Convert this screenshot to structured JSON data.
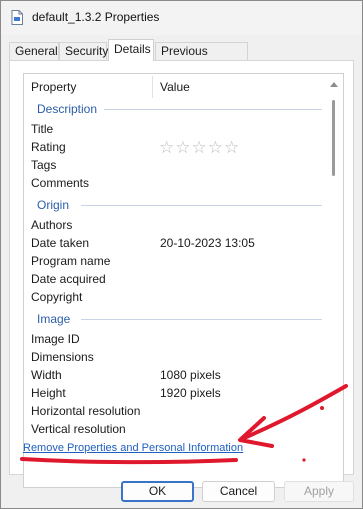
{
  "window": {
    "title": "default_1.3.2 Properties"
  },
  "tabs": [
    {
      "label": "General"
    },
    {
      "label": "Security"
    },
    {
      "label": "Details"
    },
    {
      "label": "Previous Versions"
    }
  ],
  "list": {
    "headers": {
      "property": "Property",
      "value": "Value"
    },
    "groups": {
      "description": {
        "label": "Description",
        "rows": [
          {
            "key": "Title",
            "value": ""
          },
          {
            "key": "Rating",
            "value": ""
          },
          {
            "key": "Tags",
            "value": ""
          },
          {
            "key": "Comments",
            "value": ""
          }
        ]
      },
      "origin": {
        "label": "Origin",
        "rows": [
          {
            "key": "Authors",
            "value": ""
          },
          {
            "key": "Date taken",
            "value": "20-10-2023 13:05"
          },
          {
            "key": "Program name",
            "value": ""
          },
          {
            "key": "Date acquired",
            "value": ""
          },
          {
            "key": "Copyright",
            "value": ""
          }
        ]
      },
      "image": {
        "label": "Image",
        "rows": [
          {
            "key": "Image ID",
            "value": ""
          },
          {
            "key": "Dimensions",
            "value": ""
          },
          {
            "key": "Width",
            "value": "1080 pixels"
          },
          {
            "key": "Height",
            "value": "1920 pixels"
          },
          {
            "key": "Horizontal resolution",
            "value": ""
          },
          {
            "key": "Vertical resolution",
            "value": ""
          }
        ]
      }
    },
    "rating_stars": "☆☆☆☆☆"
  },
  "link": {
    "label": "Remove Properties and Personal Information"
  },
  "buttons": {
    "ok": "OK",
    "cancel": "Cancel",
    "apply": "Apply"
  },
  "colors": {
    "accent": "#3b73c9",
    "group_label": "#2c5ea8",
    "annotation": "#e0182d"
  }
}
